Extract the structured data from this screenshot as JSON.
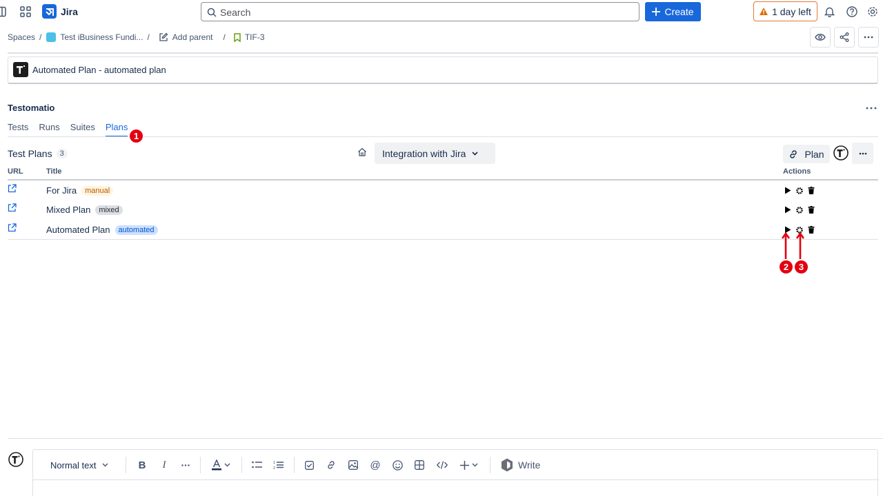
{
  "topbar": {
    "app_name": "Jira",
    "search_placeholder": "Search",
    "create_label": "Create",
    "trial_label": "1 day left"
  },
  "breadcrumb": {
    "spaces": "Spaces",
    "project": "Test iBusiness Fundi...",
    "add_parent": "Add parent",
    "issue_key": "TIF-3"
  },
  "linked_plan": {
    "label": "Automated Plan - automated plan"
  },
  "testomatio": {
    "title": "Testomatio",
    "tabs": [
      {
        "label": "Tests",
        "active": false
      },
      {
        "label": "Runs",
        "active": false
      },
      {
        "label": "Suites",
        "active": false
      },
      {
        "label": "Plans",
        "active": true
      }
    ],
    "test_plans_label": "Test Plans",
    "test_plans_count": "3",
    "suite_selector": "Integration with Jira",
    "plan_button": "Plan",
    "columns": {
      "url": "URL",
      "title": "Title",
      "actions": "Actions"
    },
    "rows": [
      {
        "title": "For Jira",
        "tag": "manual"
      },
      {
        "title": "Mixed Plan",
        "tag": "mixed"
      },
      {
        "title": "Automated Plan",
        "tag": "automated"
      }
    ]
  },
  "annotations": {
    "badge_1": "1",
    "badge_2": "2",
    "badge_3": "3"
  },
  "editor": {
    "text_style": "Normal text",
    "write_label": "Write"
  },
  "colors": {
    "brand_blue": "#1868db",
    "annotation_red": "#e3000f",
    "trial_border": "#e2783a"
  }
}
